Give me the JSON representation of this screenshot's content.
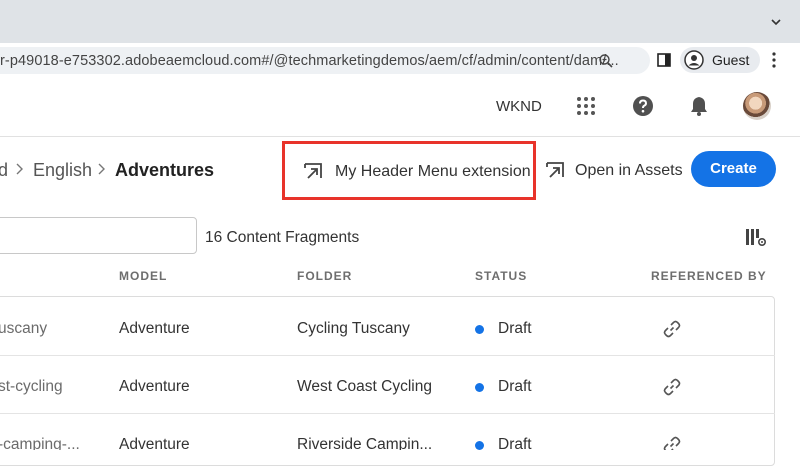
{
  "browser": {
    "url": "r-p49018-e753302.adobeaemcloud.com#/@techmarketingdemos/aem/cf/admin/content/dam/...",
    "profile_label": "Guest"
  },
  "header": {
    "org": "WKND"
  },
  "breadcrumb": {
    "items": [
      "d",
      "English"
    ],
    "current": "Adventures"
  },
  "actions": {
    "extension_label": "My Header Menu extension",
    "open_assets_label": "Open in Assets",
    "create_label": "Create"
  },
  "toolbar": {
    "search_value": "",
    "count": "16 Content Fragments"
  },
  "table": {
    "columns": [
      "MODEL",
      "FOLDER",
      "STATUS",
      "REFERENCED BY"
    ],
    "rows": [
      {
        "name": "uscany",
        "model": "Adventure",
        "folder": "Cycling Tuscany",
        "status": "Draft"
      },
      {
        "name": "st-cycling",
        "model": "Adventure",
        "folder": "West Coast Cycling",
        "status": "Draft"
      },
      {
        "name": "-camping-...",
        "model": "Adventure",
        "folder": "Riverside Campin...",
        "status": "Draft"
      }
    ]
  },
  "colors": {
    "accent": "#1473e6",
    "highlight": "#e8332a",
    "status_draft": "#1473e6"
  }
}
